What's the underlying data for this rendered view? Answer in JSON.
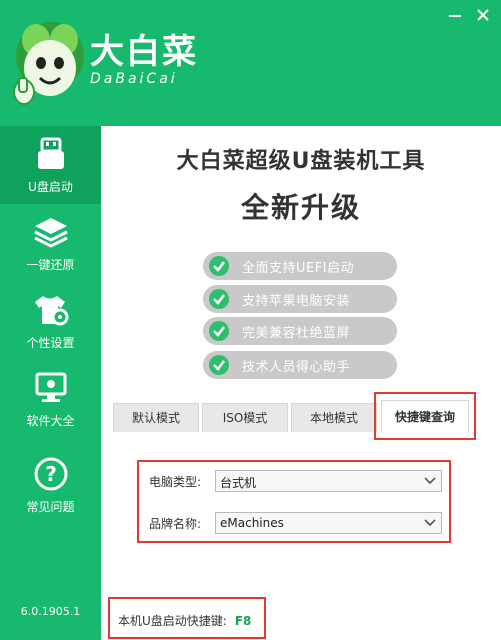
{
  "app": {
    "logo_cn": "大白菜",
    "logo_en": "DaBaiCai",
    "version": "6.0.1905.1",
    "brand_color": "#17b96e"
  },
  "window_controls": {
    "minimize_icon": "minimize-icon",
    "close_icon": "close-icon"
  },
  "sidebar": {
    "items": [
      {
        "label": "U盘启动",
        "icon": "usb-drive-icon",
        "active": true
      },
      {
        "label": "一键还原",
        "icon": "layers-icon",
        "active": false
      },
      {
        "label": "个性设置",
        "icon": "tshirt-gear-icon",
        "active": false
      },
      {
        "label": "软件大全",
        "icon": "monitor-icon",
        "active": false
      },
      {
        "label": "常见问题",
        "icon": "question-icon",
        "active": false
      }
    ]
  },
  "hero": {
    "title": "大白菜超级U盘装机工具",
    "subtitle": "全新升级",
    "features": [
      "全面支持UEFI启动",
      "支持苹果电脑安装",
      "完美兼容杜绝蓝屏",
      "技术人员得心助手"
    ]
  },
  "tabs": [
    "默认模式",
    "ISO模式",
    "本地模式",
    "快捷键查询"
  ],
  "form": {
    "computer_type_label": "电脑类型:",
    "computer_type_value": "台式机",
    "brand_label": "品牌名称:",
    "brand_value": "eMachines"
  },
  "hotkey": {
    "label": "本机U盘启动快捷键:",
    "value": "F8"
  }
}
